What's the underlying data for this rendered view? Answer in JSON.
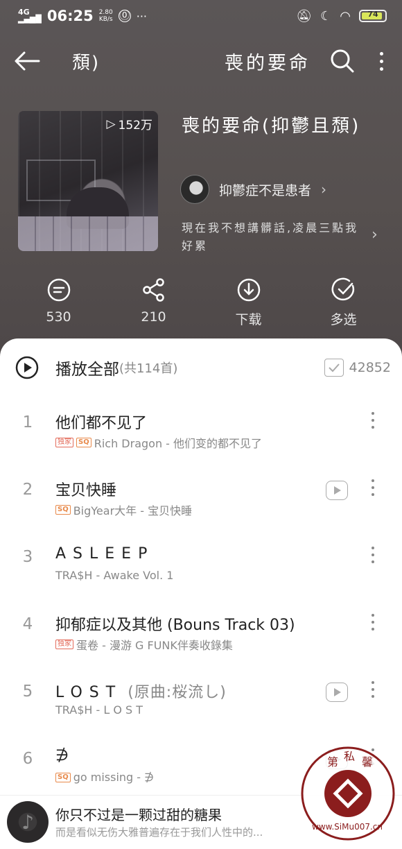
{
  "status": {
    "network": "4G HD",
    "time": "06:25",
    "speed": "2.80\nKB/s",
    "battery": "74"
  },
  "nav": {
    "short_title": "頹)",
    "title": "喪的要命"
  },
  "playlist": {
    "play_count": "152万",
    "title": "喪的要命(抑鬱且頹)",
    "author": "抑鬱症不是患者",
    "description": "現在我不想講髒話,凌晨三點我好累"
  },
  "actions": [
    {
      "label": "530",
      "icon": "comment-icon"
    },
    {
      "label": "210",
      "icon": "share-icon"
    },
    {
      "label": "下载",
      "icon": "download-icon"
    },
    {
      "label": "多选",
      "icon": "multiselect-icon"
    }
  ],
  "play_all": {
    "label": "播放全部",
    "count": "(共114首)",
    "favorites": "42852"
  },
  "songs": [
    {
      "index": "1",
      "name": "他们都不见了",
      "suffix": "",
      "badges": [
        "独家",
        "SQ"
      ],
      "meta": "Rich Dragon - 他们变的都不见了",
      "mv": false
    },
    {
      "index": "2",
      "name": "宝贝快睡",
      "suffix": "",
      "badges": [
        "SQ"
      ],
      "meta": "BigYear大年 - 宝贝快睡",
      "mv": true
    },
    {
      "index": "3",
      "name": "ASLEEP",
      "suffix": "",
      "badges": [],
      "meta": "TRA$H - Awake Vol. 1",
      "mv": false
    },
    {
      "index": "4",
      "name": "抑郁症以及其他  (Bouns Track 03)",
      "suffix": "",
      "badges": [
        "独家"
      ],
      "meta": "蛋卷 - 漫游 G FUNK伴奏收錄集",
      "mv": false
    },
    {
      "index": "5",
      "name": "LOST",
      "suffix": " (原曲:桜流し)",
      "badges": [],
      "meta": "TRA$H - L O S T",
      "mv": true
    },
    {
      "index": "6",
      "name": "∌",
      "suffix": "",
      "badges": [
        "SQ"
      ],
      "meta": "go missing - ∌",
      "mv": true
    }
  ],
  "mini_player": {
    "title": "你只不过是一颗过甜的糖果",
    "subtitle": "而是看似无伤大雅普遍存在于我们人性中的..."
  },
  "watermark": {
    "text": "第 私 馨",
    "url": "www.SiMu007.cn"
  },
  "colors": {
    "header_bg": "#56504f",
    "accent_sq": "#e8894a",
    "accent_exclusive": "#e36b5a"
  }
}
